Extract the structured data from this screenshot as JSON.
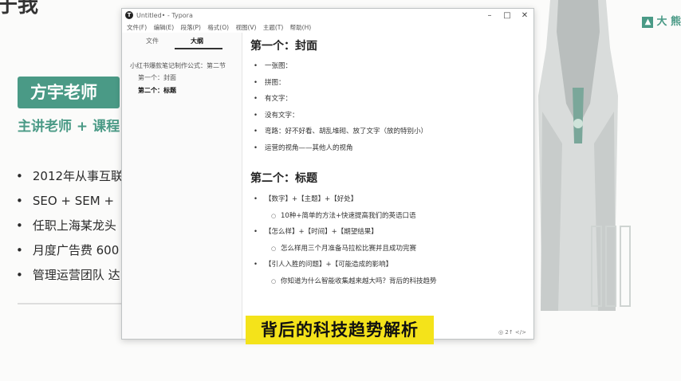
{
  "slide": {
    "title": "于我",
    "name_badge": "方宇老师",
    "subtitle": "主讲老师 + 课程",
    "bullets": [
      "2012年从事互联",
      "SEO + SEM + ",
      "任职上海某龙头",
      "月度广告费 600",
      "管理运营团队 达"
    ],
    "logo": "大 熊"
  },
  "window": {
    "app_icon": "T",
    "title": "Untitled• - Typora",
    "controls": [
      "–",
      "□",
      "✕"
    ],
    "menu": [
      "文件(F)",
      "编辑(E)",
      "段落(P)",
      "格式(O)",
      "视图(V)",
      "主题(T)",
      "帮助(H)"
    ]
  },
  "sidebar": {
    "tabs": [
      "文件",
      "大纲"
    ],
    "active_tab": "大纲",
    "outline": [
      {
        "level": 1,
        "text": "小红书爆款笔记制作公式：第二节"
      },
      {
        "level": 2,
        "text": "第一个：封面"
      },
      {
        "level": 2,
        "text": "第二个：标题",
        "active": true
      }
    ]
  },
  "editor": {
    "sections": [
      {
        "heading": "第一个：封面",
        "items": [
          {
            "text": "一张图："
          },
          {
            "text": "拼图："
          },
          {
            "text": "有文字："
          },
          {
            "text": "没有文字："
          },
          {
            "text": "弯路：好不好看、胡乱堆砌、放了文字（放的特别小）"
          },
          {
            "text": "运营的视角——其他人的视角"
          }
        ]
      },
      {
        "heading": "第二个：标题",
        "items": [
          {
            "text": "【数字】+【主题】+【好处】",
            "sub": "10种+简单的方法+快速提高我们的英语口语"
          },
          {
            "text": "【怎么样】+【时间】+【期望结果】",
            "sub": "怎么样用三个月准备马拉松比赛并且成功完赛"
          },
          {
            "text": "【引人入胜的问题】+【可能造成的影响】",
            "sub": "你知道为什么智能收集越来越大吗？背后的科技趋势"
          }
        ]
      }
    ],
    "status": "◎ 2↑  </>"
  },
  "caption": "背后的科技趋势解析"
}
